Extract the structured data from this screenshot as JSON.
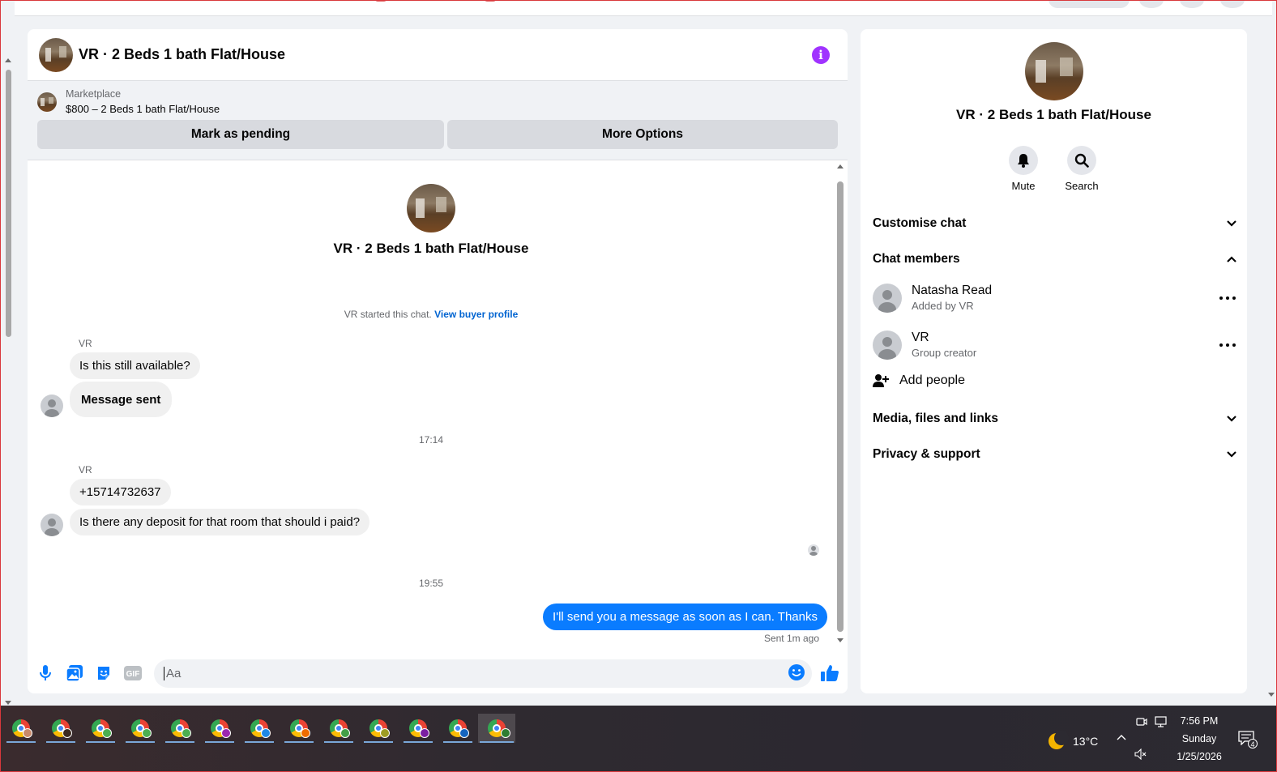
{
  "chat": {
    "title": "VR · 2 Beds 1 bath Flat/House",
    "marketplace_label": "Marketplace",
    "listing": "$800 – 2 Beds 1 bath Flat/House",
    "mark_pending": "Mark as pending",
    "more_options": "More Options",
    "intro_title": "VR · 2 Beds 1 bath Flat/House",
    "started_text": "VR started this chat.",
    "buyer_profile_link": "View buyer profile",
    "messages": [
      {
        "sender": "VR",
        "text": "Is this still available?"
      },
      {
        "text": "Message sent"
      },
      {
        "time": "17:14"
      },
      {
        "sender": "VR",
        "text": "+15714732637"
      },
      {
        "text": "Is there any deposit for that room that should i paid?"
      },
      {
        "time": "19:55"
      },
      {
        "text": "I'll send you a message as soon as I can. Thanks",
        "outgoing": true
      },
      {
        "status": "Sent 1m ago"
      }
    ],
    "composer_placeholder": "Aa"
  },
  "info": {
    "title": "VR · 2 Beds 1 bath Flat/House",
    "mute": "Mute",
    "search": "Search",
    "sections": {
      "customise": "Customise chat",
      "members": "Chat members",
      "media": "Media, files and links",
      "privacy": "Privacy & support"
    },
    "members": [
      {
        "name": "Natasha Read",
        "sub": "Added by VR"
      },
      {
        "name": "VR",
        "sub": "Group creator"
      }
    ],
    "add_people": "Add people"
  },
  "taskbar": {
    "temperature": "13°C",
    "time": "7:56 PM",
    "day": "Sunday",
    "date": "1/25/2026",
    "notifications": "4"
  },
  "colors": {
    "accent": "#0a7cff",
    "info_icon": "#a033ff",
    "link": "#0064d1"
  }
}
